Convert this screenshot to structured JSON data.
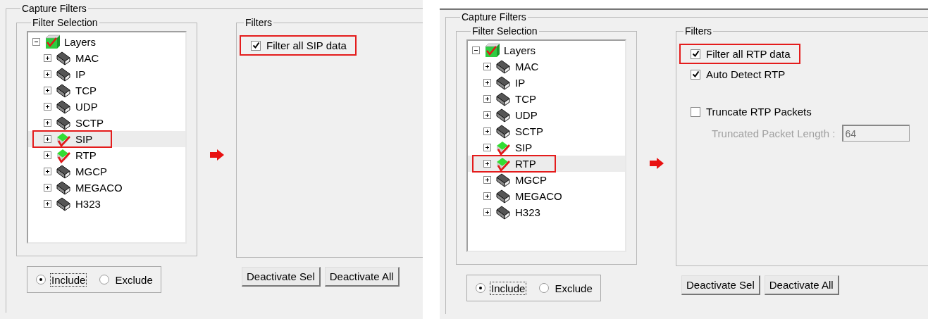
{
  "panels": [
    {
      "title": "Capture Filters",
      "selection": {
        "title": "Filter Selection",
        "root": {
          "label": "Layers",
          "expanded": true,
          "checked": true,
          "children": [
            {
              "label": "MAC",
              "expanded": false,
              "checked": false,
              "selected": false
            },
            {
              "label": "IP",
              "expanded": false,
              "checked": false,
              "selected": false
            },
            {
              "label": "TCP",
              "expanded": false,
              "checked": false,
              "selected": false
            },
            {
              "label": "UDP",
              "expanded": false,
              "checked": false,
              "selected": false
            },
            {
              "label": "SCTP",
              "expanded": false,
              "checked": false,
              "selected": false
            },
            {
              "label": "SIP",
              "expanded": false,
              "checked": true,
              "selected": true
            },
            {
              "label": "RTP",
              "expanded": false,
              "checked": true,
              "selected": false
            },
            {
              "label": "MGCP",
              "expanded": false,
              "checked": false,
              "selected": false
            },
            {
              "label": "MEGACO",
              "expanded": false,
              "checked": false,
              "selected": false
            },
            {
              "label": "H323",
              "expanded": false,
              "checked": false,
              "selected": false
            }
          ]
        }
      },
      "mode": [
        {
          "label": "Include",
          "selected": true
        },
        {
          "label": "Exclude",
          "selected": false
        }
      ],
      "filters": {
        "title": "Filters",
        "options": [
          {
            "kind": "checkbox",
            "label": "Filter all SIP data",
            "checked": true,
            "highlighted": true
          }
        ]
      },
      "buttons": [
        "Deactivate Sel",
        "Deactivate All"
      ]
    },
    {
      "title": "Capture Filters",
      "selection": {
        "title": "Filter Selection",
        "root": {
          "label": "Layers",
          "expanded": true,
          "checked": true,
          "children": [
            {
              "label": "MAC",
              "expanded": false,
              "checked": false,
              "selected": false
            },
            {
              "label": "IP",
              "expanded": false,
              "checked": false,
              "selected": false
            },
            {
              "label": "TCP",
              "expanded": false,
              "checked": false,
              "selected": false
            },
            {
              "label": "UDP",
              "expanded": false,
              "checked": false,
              "selected": false
            },
            {
              "label": "SCTP",
              "expanded": false,
              "checked": false,
              "selected": false
            },
            {
              "label": "SIP",
              "expanded": false,
              "checked": true,
              "selected": false
            },
            {
              "label": "RTP",
              "expanded": false,
              "checked": true,
              "selected": true
            },
            {
              "label": "MGCP",
              "expanded": false,
              "checked": false,
              "selected": false
            },
            {
              "label": "MEGACO",
              "expanded": false,
              "checked": false,
              "selected": false
            },
            {
              "label": "H323",
              "expanded": false,
              "checked": false,
              "selected": false
            }
          ]
        }
      },
      "mode": [
        {
          "label": "Include",
          "selected": true
        },
        {
          "label": "Exclude",
          "selected": false
        }
      ],
      "filters": {
        "title": "Filters",
        "options": [
          {
            "kind": "checkbox",
            "label": "Filter all RTP data",
            "checked": true,
            "highlighted": true
          },
          {
            "kind": "checkbox",
            "label": "Auto Detect RTP",
            "checked": true,
            "highlighted": false
          },
          {
            "kind": "spacer"
          },
          {
            "kind": "checkbox",
            "label": "Truncate RTP Packets",
            "checked": false,
            "highlighted": false
          },
          {
            "kind": "field",
            "label": "Truncated Packet Length :",
            "value": "64",
            "disabled": true
          }
        ]
      },
      "buttons": [
        "Deactivate Sel",
        "Deactivate All"
      ]
    }
  ]
}
